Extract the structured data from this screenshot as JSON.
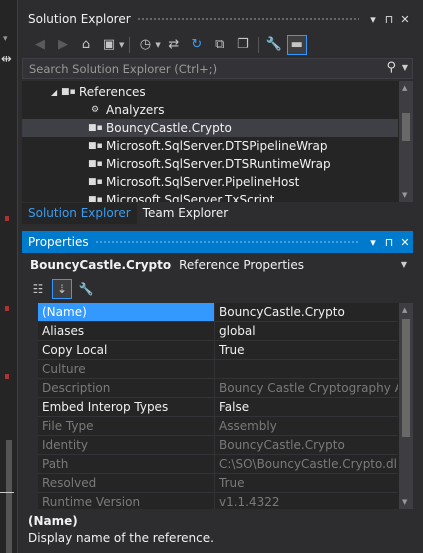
{
  "solution_explorer": {
    "title": "Solution Explorer",
    "title_buttons": {
      "dropdown": "▾",
      "pin": "⊓",
      "close": "✕"
    },
    "search": {
      "placeholder": "Search Solution Explorer (Ctrl+;)"
    },
    "tree": [
      {
        "label": "References",
        "icon": "references-icon",
        "expanded": true,
        "selected": false
      },
      {
        "label": "Analyzers",
        "icon": "analyzers-icon",
        "selected": false
      },
      {
        "label": "BouncyCastle.Crypto",
        "icon": "assembly-icon",
        "selected": true
      },
      {
        "label": "Microsoft.SqlServer.DTSPipelineWrap",
        "icon": "assembly-icon",
        "selected": false
      },
      {
        "label": "Microsoft.SqlServer.DTSRuntimeWrap",
        "icon": "assembly-icon",
        "selected": false
      },
      {
        "label": "Microsoft.SqlServer.PipelineHost",
        "icon": "assembly-icon",
        "selected": false
      },
      {
        "label": "Microsoft.SqlServer.TxScript",
        "icon": "assembly-icon",
        "selected": false
      }
    ],
    "tabs": [
      {
        "label": "Solution Explorer",
        "active": true
      },
      {
        "label": "Team Explorer",
        "active": false
      }
    ]
  },
  "properties": {
    "title": "Properties",
    "title_buttons": {
      "dropdown": "▾",
      "pin": "⊓",
      "close": "✕"
    },
    "object_name": "BouncyCastle.Crypto",
    "object_type": "Reference Properties",
    "rows": [
      {
        "name": "(Name)",
        "value": "BouncyCastle.Crypto",
        "readonly": false,
        "selected": true
      },
      {
        "name": "Aliases",
        "value": "global",
        "readonly": false,
        "selected": false
      },
      {
        "name": "Copy Local",
        "value": "True",
        "readonly": false,
        "selected": false
      },
      {
        "name": "Culture",
        "value": "",
        "readonly": true,
        "selected": false
      },
      {
        "name": "Description",
        "value": "Bouncy Castle Cryptography API",
        "readonly": true,
        "selected": false
      },
      {
        "name": "Embed Interop Types",
        "value": "False",
        "readonly": false,
        "selected": false
      },
      {
        "name": "File Type",
        "value": "Assembly",
        "readonly": true,
        "selected": false
      },
      {
        "name": "Identity",
        "value": "BouncyCastle.Crypto",
        "readonly": true,
        "selected": false
      },
      {
        "name": "Path",
        "value": "C:\\SO\\BouncyCastle.Crypto.dll",
        "readonly": true,
        "selected": false
      },
      {
        "name": "Resolved",
        "value": "True",
        "readonly": true,
        "selected": false
      },
      {
        "name": "Runtime Version",
        "value": "v1.1.4322",
        "readonly": true,
        "selected": false
      }
    ],
    "description": {
      "title": "(Name)",
      "text": "Display name of the reference."
    }
  },
  "colors": {
    "accent": "#007acc",
    "selection": "#3399ff",
    "background": "#2d2d30",
    "panel": "#252526"
  }
}
